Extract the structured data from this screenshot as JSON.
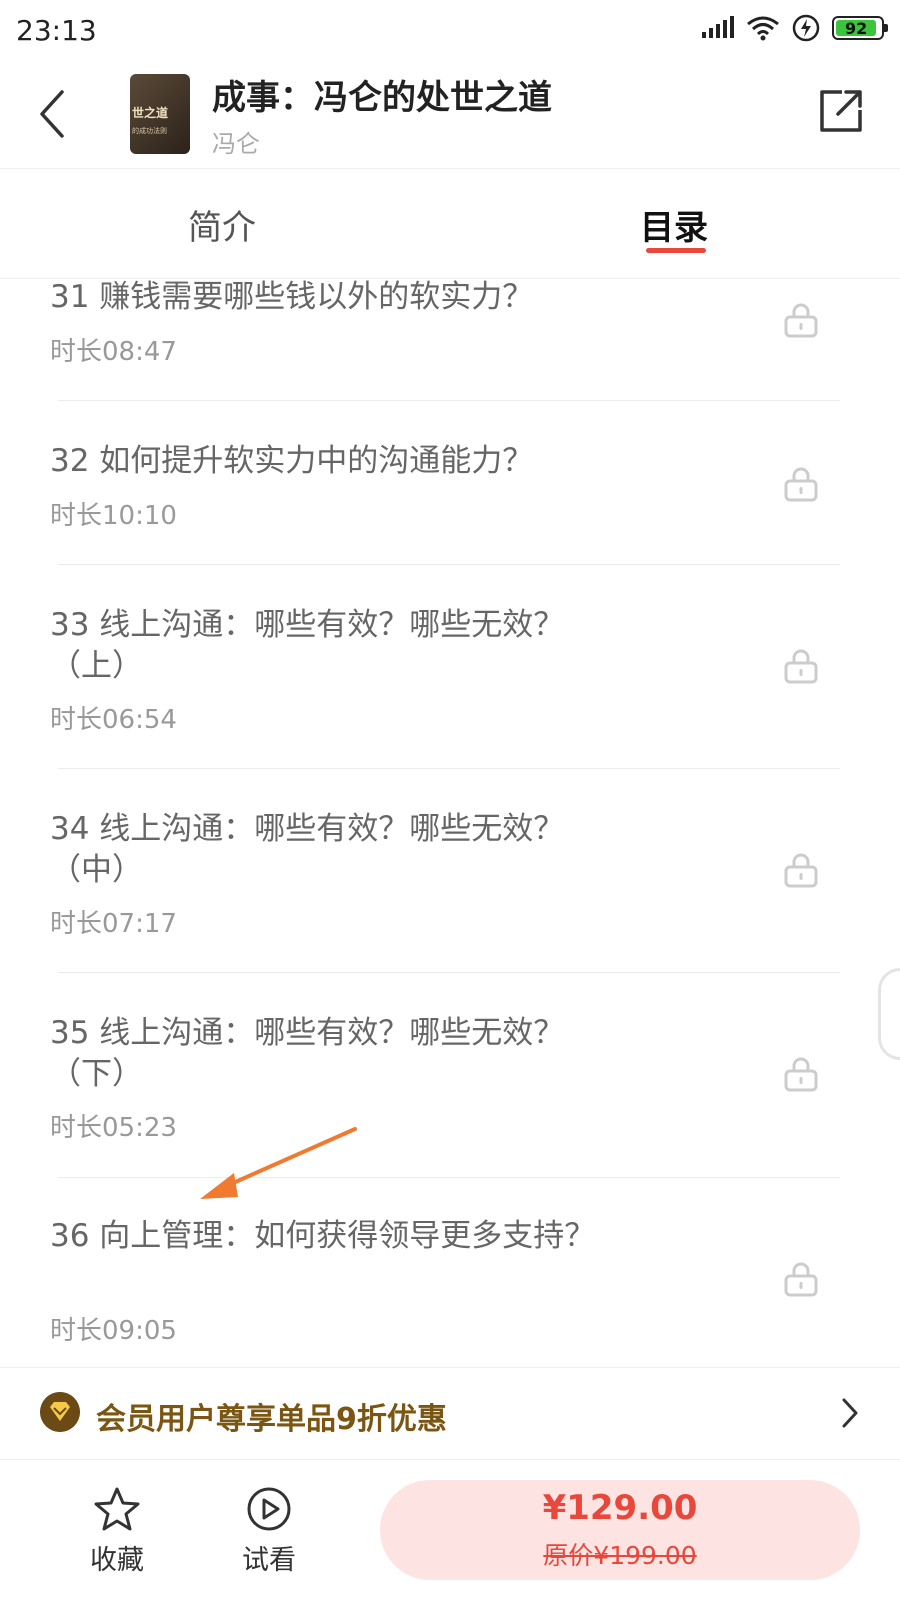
{
  "status_bar": {
    "time": "23:13",
    "battery": "92",
    "battery_level": 92
  },
  "header": {
    "book_title": "成事：冯仑的处世之道",
    "author": "冯仑",
    "cover_text": "世之道",
    "cover_subtext": "的成功法则"
  },
  "tabs": [
    {
      "label": "简介",
      "active": false
    },
    {
      "label": "目录",
      "active": true
    }
  ],
  "chapters": [
    {
      "title": "31 赚钱需要哪些钱以外的软实力？",
      "duration": "时长08:47",
      "locked": true
    },
    {
      "title": "32 如何提升软实力中的沟通能力？",
      "duration": "时长10:10",
      "locked": true
    },
    {
      "title": "33 线上沟通：哪些有效？哪些无效？（上）",
      "duration": "时长06:54",
      "locked": true
    },
    {
      "title": "34 线上沟通：哪些有效？哪些无效？（中）",
      "duration": "时长07:17",
      "locked": true
    },
    {
      "title": "35 线上沟通：哪些有效？哪些无效？（下）",
      "duration": "时长05:23",
      "locked": true
    },
    {
      "title": "36 向上管理：如何获得领导更多支持？",
      "duration": "时长09:05",
      "locked": true
    }
  ],
  "promo": {
    "text": "会员用户尊享单品9折优惠"
  },
  "bottom_bar": {
    "favorite_label": "收藏",
    "trial_label": "试看",
    "price": "¥129.00",
    "original_price": "原价¥199.00"
  },
  "colors": {
    "accent": "#e8483b",
    "promo_text": "#7b5512",
    "buy_button_bg": "#fde3e1",
    "annotation_arrow": "#f07a30"
  }
}
